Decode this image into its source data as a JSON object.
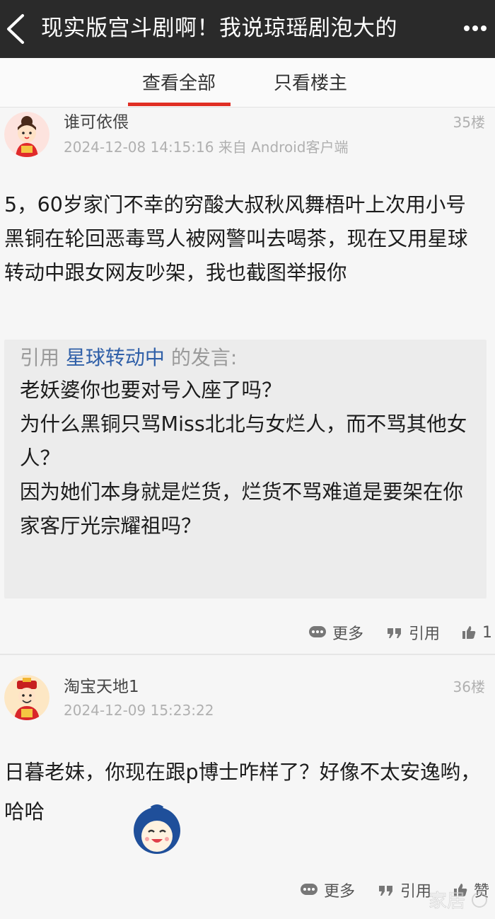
{
  "header": {
    "title": "现实版宫斗剧啊！我说琼瑶剧泡大的",
    "back_icon": "back-chevron-icon",
    "more_icon": "more-dots-icon"
  },
  "tabs": [
    {
      "label": "查看全部",
      "active": true
    },
    {
      "label": "只看楼主",
      "active": false
    }
  ],
  "accent_color": "#e02e24",
  "posts": [
    {
      "author": "谁可依偎",
      "meta": "2024-12-08 14:15:16 来自 Android客户端",
      "floor": "35楼",
      "content": "5，60岁家门不幸的穷酸大叔秋风舞梧叶上次用小号黑铜在轮回恶毒骂人被网警叫去喝茶，现在又用星球转动中跟女网友吵架，我也截图举报你",
      "quote": {
        "prefix": "引用",
        "user": "星球转动中",
        "suffix": "的发言:",
        "lines": [
          "老妖婆你也要对号入座了吗？",
          "为什么黑铜只骂Miss北北与女烂人，而不骂其他女人？",
          "因为她们本身就是烂货，烂货不骂难道是要架在你家客厅光宗耀祖吗？"
        ]
      },
      "actions": {
        "more": "更多",
        "quote": "引用",
        "like_count": "1"
      }
    },
    {
      "author": "淘宝天地1",
      "meta": "2024-12-09 15:23:22",
      "floor": "36楼",
      "content": "日暮老妹，你现在跟p博士咋样了？好像不太安逸哟，哈哈",
      "actions": {
        "more": "更多",
        "quote": "引用",
        "like_label": "赞"
      }
    }
  ],
  "watermark": "家居"
}
